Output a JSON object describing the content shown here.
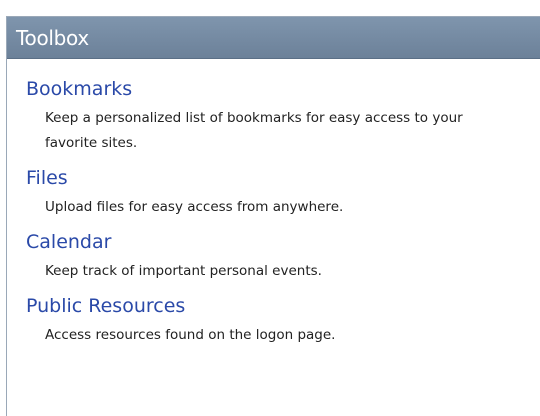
{
  "toolbox": {
    "title": "Toolbox",
    "items": [
      {
        "title": "Bookmarks",
        "description": "Keep a personalized list of bookmarks for easy access to your favorite sites."
      },
      {
        "title": "Files",
        "description": "Upload files for easy access from anywhere."
      },
      {
        "title": "Calendar",
        "description": "Keep track of important personal events."
      },
      {
        "title": "Public Resources",
        "description": "Access resources found on the logon page."
      }
    ]
  }
}
